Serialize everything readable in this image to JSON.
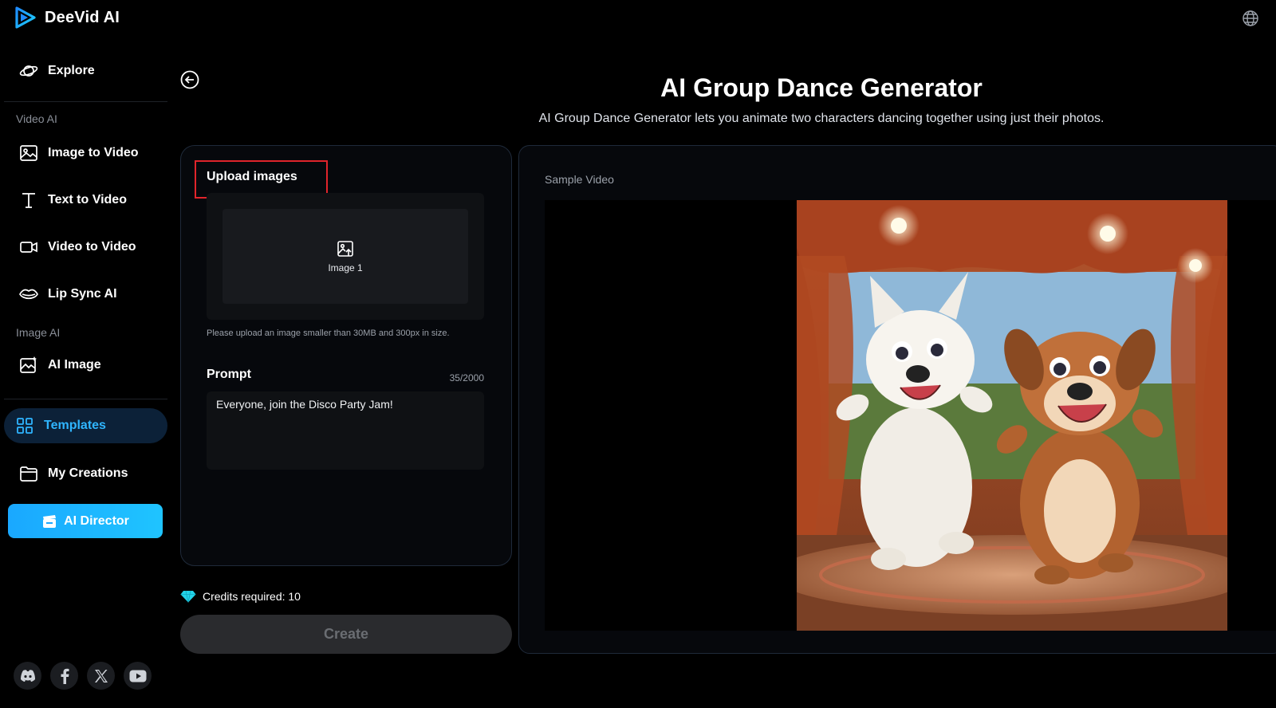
{
  "brand": {
    "name": "DeeVid AI"
  },
  "sidebar": {
    "explore": "Explore",
    "section_video": "Video AI",
    "video_items": [
      "Image to Video",
      "Text to Video",
      "Video to Video",
      "Lip Sync AI"
    ],
    "section_image": "Image AI",
    "image_items": [
      "AI Image"
    ],
    "templates": "Templates",
    "my_creations": "My Creations",
    "ai_director": "AI Director"
  },
  "header": {
    "title": "AI Group Dance Generator",
    "subtitle": "AI Group Dance Generator lets you animate two characters dancing together using just their photos."
  },
  "upload": {
    "title": "Upload images",
    "slot_label": "Image 1",
    "hint": "Please upload an image smaller than 30MB and 300px in size."
  },
  "prompt": {
    "label": "Prompt",
    "count": "35/2000",
    "value": "Everyone, join the Disco Party Jam!"
  },
  "credits": {
    "text": "Credits required: 10"
  },
  "create": {
    "label": "Create"
  },
  "sample": {
    "label": "Sample Video"
  },
  "colors": {
    "accent": "#1fb6ff",
    "highlight_box": "#e0242b",
    "panel_border": "#1f2a3a"
  }
}
